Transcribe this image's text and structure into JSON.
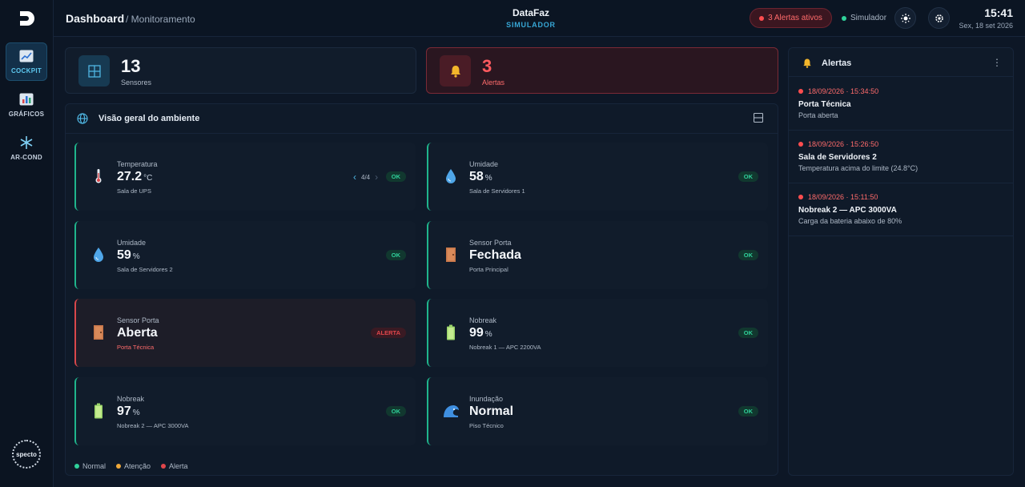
{
  "sidebar": {
    "items": [
      {
        "label": "COCKPIT",
        "icon": "chart-line-icon",
        "active": true
      },
      {
        "label": "GRÁFICOS",
        "icon": "bar-chart-icon",
        "active": false
      },
      {
        "label": "AR-COND",
        "icon": "snowflake-icon",
        "active": false
      }
    ],
    "brand_badge": "specto"
  },
  "header": {
    "title": "Dashboard",
    "breadcrumb": "/ Monitoramento",
    "brand": "DataFaz",
    "mode": "SIMULADOR",
    "alerts_pill": "3 Alertas ativos",
    "simulator_label": "Simulador",
    "time": "15:41",
    "date": "Sex, 18 set 2026"
  },
  "stats": {
    "sensors": {
      "value": "13",
      "label": "Sensores"
    },
    "alerts": {
      "value": "3",
      "label": "Alertas"
    }
  },
  "overview": {
    "title": "Visão geral do ambiente",
    "cards": [
      {
        "type": "Temperatura",
        "value": "27.2",
        "unit": "°C",
        "location": "Sala de UPS",
        "status": "OK",
        "pager": "4/4",
        "icon": "thermometer-icon"
      },
      {
        "type": "Umidade",
        "value": "58",
        "unit": "%",
        "location": "Sala de Servidores 1",
        "status": "OK",
        "icon": "water-drop-icon"
      },
      {
        "type": "Umidade",
        "value": "59",
        "unit": "%",
        "location": "Sala de Servidores 2",
        "status": "OK",
        "icon": "water-drop-icon"
      },
      {
        "type": "Sensor Porta",
        "value": "Fechada",
        "unit": "",
        "location": "Porta Principal",
        "status": "OK",
        "icon": "door-icon"
      },
      {
        "type": "Sensor Porta",
        "value": "Aberta",
        "unit": "",
        "location": "Porta Técnica",
        "status": "ALERTA",
        "icon": "door-icon"
      },
      {
        "type": "Nobreak",
        "value": "99",
        "unit": "%",
        "location": "Nobreak 1 — APC 2200VA",
        "status": "OK",
        "icon": "battery-icon"
      },
      {
        "type": "Nobreak",
        "value": "97",
        "unit": "%",
        "location": "Nobreak 2 — APC 3000VA",
        "status": "OK",
        "icon": "battery-icon"
      },
      {
        "type": "Inundação",
        "value": "Normal",
        "unit": "",
        "location": "Piso Técnico",
        "status": "OK",
        "icon": "wave-icon"
      }
    ],
    "legend": [
      "Normal",
      "Atenção",
      "Alerta"
    ]
  },
  "alerts_panel": {
    "title": "Alertas",
    "items": [
      {
        "timestamp": "18/09/2026 · 15:34:50",
        "title": "Porta Técnica",
        "description": "Porta aberta"
      },
      {
        "timestamp": "18/09/2026 · 15:26:50",
        "title": "Sala de Servidores 2",
        "description": "Temperatura acima do limite (24.8°C)"
      },
      {
        "timestamp": "18/09/2026 · 15:11:50",
        "title": "Nobreak 2 — APC 3000VA",
        "description": "Carga da bateria abaixo de 80%"
      }
    ]
  },
  "colors": {
    "background": "#0d1726",
    "ok": "#2fd19a",
    "alert": "#e0464b",
    "warning": "#f0a93a",
    "accent": "#37a7d6"
  }
}
